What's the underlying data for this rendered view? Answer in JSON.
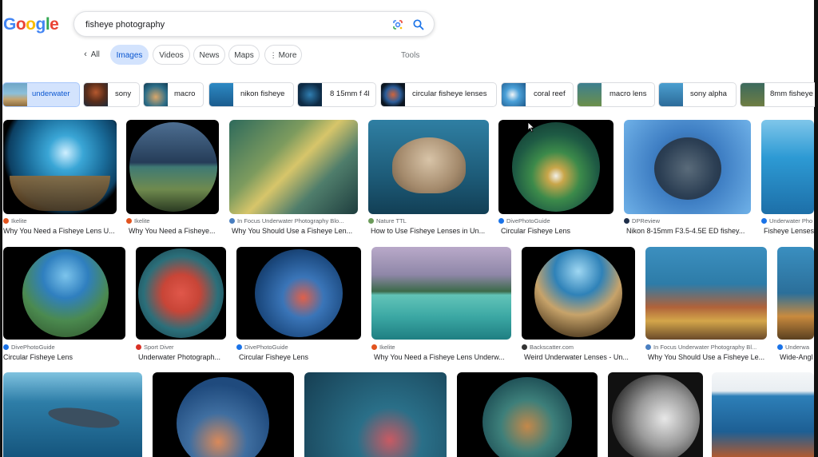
{
  "logo": {
    "letters": [
      "G",
      "o",
      "o",
      "g",
      "l",
      "e"
    ],
    "colors": [
      "#4285f4",
      "#ea4335",
      "#fbbc05",
      "#4285f4",
      "#34a853",
      "#ea4335"
    ]
  },
  "search": {
    "query": "fisheye photography"
  },
  "icons": {
    "lens": "google-lens-icon",
    "search": "search-icon"
  },
  "tabs": {
    "all": "All",
    "images": "Images",
    "videos": "Videos",
    "news": "News",
    "maps": "Maps",
    "more": "More",
    "tools": "Tools"
  },
  "chips": [
    {
      "label": "underwater",
      "selected": true
    },
    {
      "label": "sony"
    },
    {
      "label": "macro"
    },
    {
      "label": "nikon fisheye"
    },
    {
      "label": "8 15mm f 4l"
    },
    {
      "label": "circular fisheye lenses"
    },
    {
      "label": "coral reef"
    },
    {
      "label": "macro lens"
    },
    {
      "label": "sony alpha"
    },
    {
      "label": "8mm fisheye"
    }
  ],
  "results": {
    "row1": [
      {
        "source": "Ikelite",
        "title": "Why You Need a Fisheye Lens U..."
      },
      {
        "source": "Ikelite",
        "title": "Why You Need a Fisheye..."
      },
      {
        "source": "In Focus Underwater Photography Blo...",
        "title": "Why You Should Use a Fisheye Len..."
      },
      {
        "source": "Nature TTL",
        "title": "How to Use Fisheye Lenses in Un..."
      },
      {
        "source": "DivePhotoGuide",
        "title": "Circular Fisheye Lens"
      },
      {
        "source": "DPReview",
        "title": "Nikon 8-15mm F3.5-4.5E ED fishey..."
      },
      {
        "source": "Underwater Pho",
        "title": "Fisheye Lenses"
      }
    ],
    "row2": [
      {
        "source": "DivePhotoGuide",
        "title": "Circular Fisheye Lens"
      },
      {
        "source": "Sport Diver",
        "title": "Underwater Photograph..."
      },
      {
        "source": "DivePhotoGuide",
        "title": "Circular Fisheye Lens"
      },
      {
        "source": "Ikelite",
        "title": "Why You Need a Fisheye Lens Underw..."
      },
      {
        "source": "Backscatter.com",
        "title": "Weird Underwater Lenses - Un..."
      },
      {
        "source": "In Focus Underwater Photography Bl...",
        "title": "Why You Should Use a Fisheye Le..."
      },
      {
        "source": "Underwa",
        "title": "Wide-Angl"
      }
    ]
  }
}
